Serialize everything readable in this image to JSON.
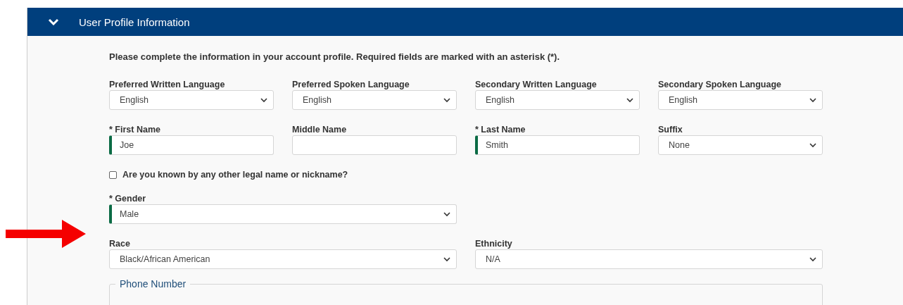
{
  "panel": {
    "title": "User Profile Information",
    "expanded": true
  },
  "intro": "Please complete the information in your account profile. Required fields are marked with an asterisk (*).",
  "rows": [
    {
      "fields": [
        {
          "kind": "select",
          "label": "Preferred Written Language",
          "value": "English",
          "required": false,
          "wide": false
        },
        {
          "kind": "select",
          "label": "Preferred Spoken Language",
          "value": "English",
          "required": false,
          "wide": false
        },
        {
          "kind": "select",
          "label": "Secondary Written Language",
          "value": "English",
          "required": false,
          "wide": false
        },
        {
          "kind": "select",
          "label": "Secondary Spoken Language",
          "value": "English",
          "required": false,
          "wide": false
        }
      ]
    },
    {
      "fields": [
        {
          "kind": "text",
          "label": "* First Name",
          "value": "Joe",
          "required": true,
          "wide": false
        },
        {
          "kind": "text",
          "label": "Middle Name",
          "required": false,
          "wide": false
        },
        {
          "kind": "text",
          "label": "* Last Name",
          "value": "Smith",
          "required": true,
          "wide": false
        },
        {
          "kind": "select",
          "label": "Suffix",
          "value": "None",
          "required": false,
          "wide": false
        }
      ]
    },
    {
      "fields": [
        {
          "kind": "checkbox",
          "label": "Are you known by any other legal name or nickname?",
          "checked": false
        }
      ]
    },
    {
      "fields": [
        {
          "kind": "select",
          "label": "* Gender",
          "value": "Male",
          "required": true,
          "wide": true
        }
      ]
    },
    {
      "fields": [
        {
          "kind": "select",
          "label": "Race",
          "value": "Black/African American",
          "required": false,
          "wide": true
        },
        {
          "kind": "select",
          "label": "Ethnicity",
          "value": "N/A",
          "required": false,
          "wide": true
        }
      ]
    }
  ],
  "fieldset": {
    "legend": "Phone Number"
  },
  "annotation_arrow": true
}
